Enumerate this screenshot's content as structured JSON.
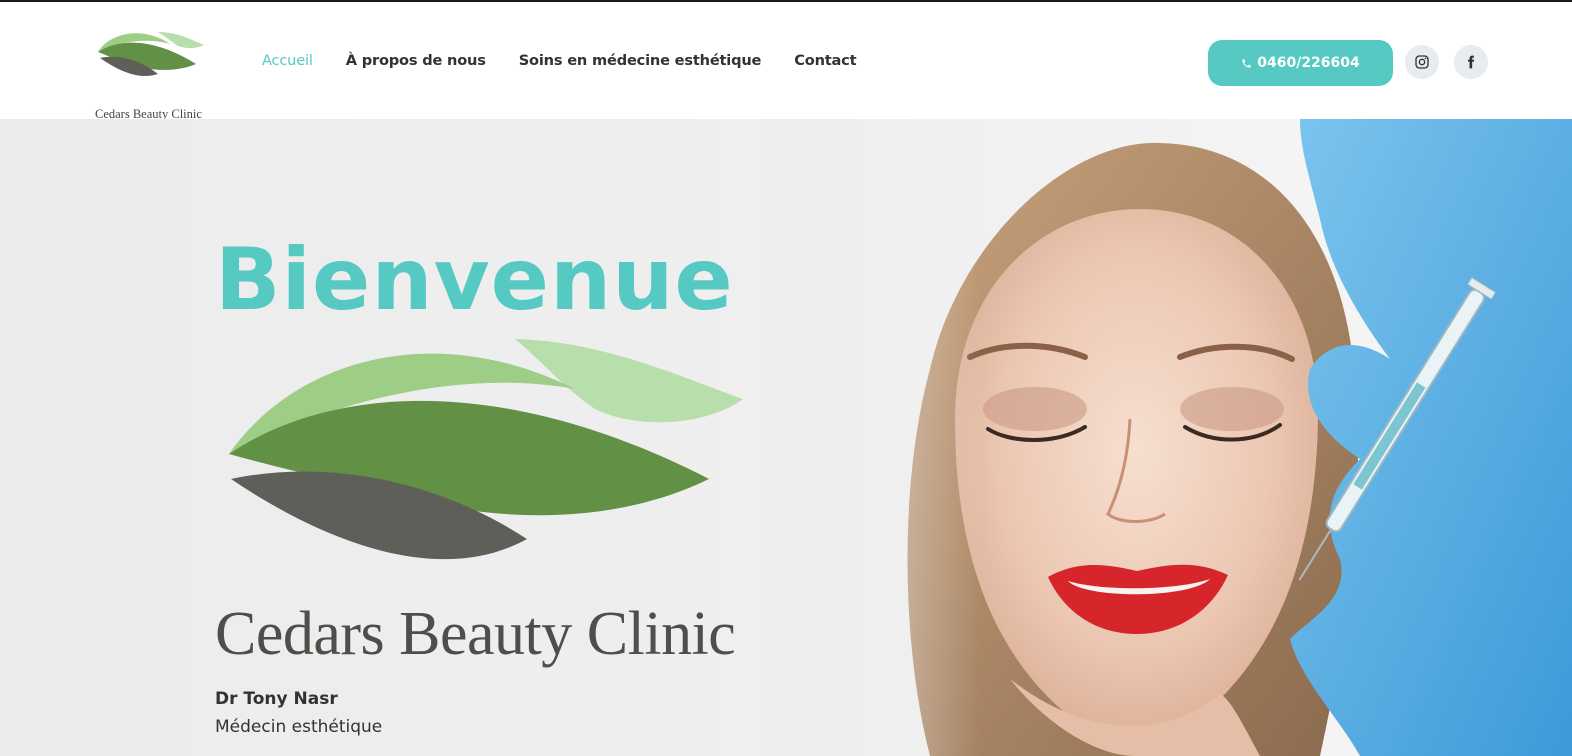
{
  "brand": {
    "logo_text": "Cedars Beauty Clinic",
    "name": "Cedars Beauty Clinic",
    "colors": {
      "accent": "#56cac2",
      "leaf_light": "#9ecd86",
      "leaf_dark": "#629145",
      "leaf_pale": "#b8dfab",
      "leaf_gray": "#5f5f5a"
    }
  },
  "nav": {
    "items": [
      {
        "label": "Accueil",
        "active": true
      },
      {
        "label": "À propos de nous",
        "active": false
      },
      {
        "label": "Soins en médecine esthétique",
        "active": false
      },
      {
        "label": "Contact",
        "active": false
      }
    ]
  },
  "header_actions": {
    "phone_label": "0460/226604",
    "phone_icon": "phone-icon",
    "social": [
      "instagram-icon",
      "facebook-icon"
    ]
  },
  "hero": {
    "title": "Bienvenue",
    "doctor_name": "Dr Tony Nasr",
    "doctor_role": "Médecin esthétique"
  }
}
